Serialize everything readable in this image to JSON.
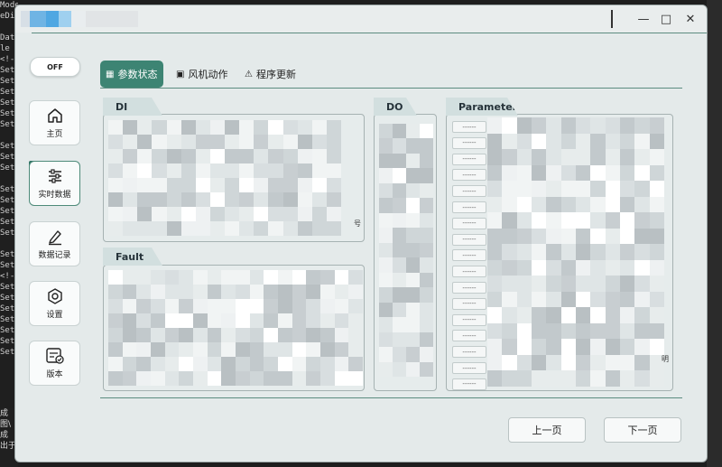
{
  "background": {
    "code_lines": [
      "Mode",
      "eDic",
      "",
      "Data",
      "le",
      "<!-",
      "Set",
      "Set",
      "Set",
      "Set",
      "Set",
      "Set",
      "",
      "Set",
      "Set",
      "Set",
      "",
      "Set",
      "Set",
      "Set",
      "Set",
      "Set",
      "",
      "Set",
      "Set",
      "<!-",
      "Set",
      "Set",
      "Set",
      "Set",
      "Set",
      "Set",
      "Set"
    ],
    "bottom_text": [
      "成",
      "图\\",
      "成",
      "出于"
    ]
  },
  "toggle": {
    "label": "OFF"
  },
  "nav": [
    {
      "label": "主页",
      "icon": "home-icon"
    },
    {
      "label": "实时数据",
      "icon": "sliders-icon",
      "active": true
    },
    {
      "label": "数据记录",
      "icon": "pen-icon"
    },
    {
      "label": "设置",
      "icon": "hexagon-settings-icon"
    },
    {
      "label": "版本",
      "icon": "version-icon"
    }
  ],
  "tabs": [
    {
      "label": "参数状态",
      "icon": "grid-icon",
      "active": true
    },
    {
      "label": "风机动作",
      "icon": "frame-icon"
    },
    {
      "label": "程序更新",
      "icon": "warning-icon"
    }
  ],
  "panels": {
    "di": {
      "title": "DI",
      "corner_text": "号"
    },
    "fault": {
      "title": "Fault"
    },
    "do": {
      "title": "DO"
    },
    "parameter": {
      "title": "Parameter",
      "row_labels": [
        "------",
        "------",
        "------",
        "------",
        "------",
        "------",
        "------",
        "------",
        "------",
        "------",
        "------",
        "------",
        "------",
        "------",
        "------",
        "------",
        "------"
      ],
      "corner_text": "明"
    }
  },
  "buttons": {
    "prev": "上一页",
    "next": "下一页"
  },
  "colors": {
    "accent": "#3d8473",
    "line": "#5c8c80",
    "panel_title": "#d2dfdf"
  }
}
